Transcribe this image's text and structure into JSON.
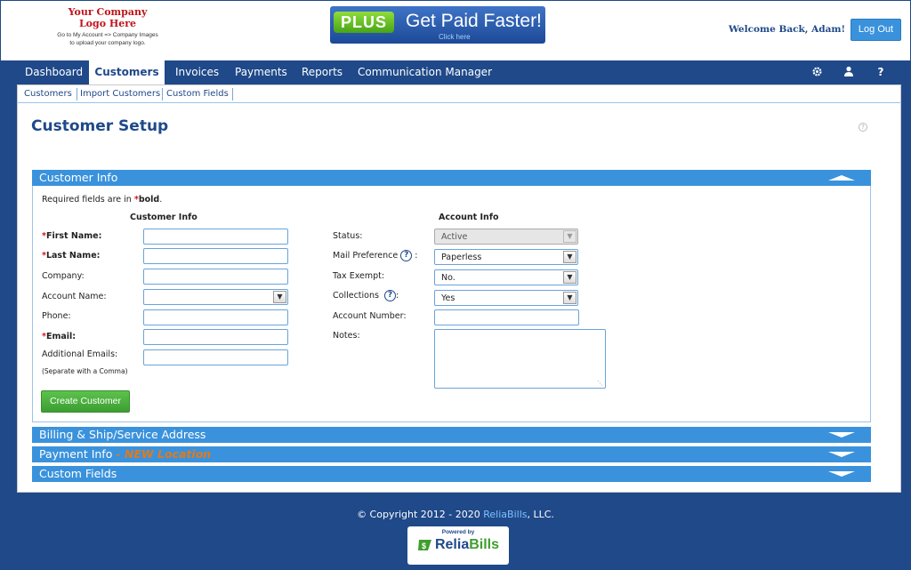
{
  "header": {
    "company_logo_title": "Your Company\nLogo Here",
    "company_logo_hint": "Go to My Account => Company Images to upload your company logo.",
    "promo": {
      "plus": "PLUS",
      "title": "Get Paid Faster!",
      "click": "Click here"
    },
    "welcome": "Welcome Back, Adam!",
    "logout_label": "Log Out"
  },
  "nav": {
    "items": [
      "Dashboard",
      "Customers",
      "Invoices",
      "Payments",
      "Reports",
      "Communication Manager"
    ],
    "active": "Customers",
    "icons": [
      "gear-icon",
      "user-icon",
      "help-icon"
    ]
  },
  "subnav": [
    "Customers",
    "Import Customers",
    "Custom Fields"
  ],
  "page": {
    "title": "Customer Setup"
  },
  "sections": {
    "customer_info": "Customer Info",
    "billing": "Billing & Ship/Service Address",
    "payment": "Payment Info",
    "payment_new": "- NEW Location",
    "custom_fields": "Custom Fields"
  },
  "form": {
    "required_note_prefix": "Required fields are in ",
    "required_note_star": "*",
    "required_note_bold": "bold",
    "required_note_suffix": ".",
    "left_heading": "Customer Info",
    "right_heading": "Account Info",
    "first_name": "First Name:",
    "last_name": "Last Name:",
    "company": "Company:",
    "account_name": "Account Name:",
    "phone": "Phone:",
    "email": "Email:",
    "additional_emails": "Additional Emails:",
    "additional_hint": "(Separate with a Comma)",
    "status": "Status:",
    "status_value": "Active",
    "mail_pref": "Mail Preference",
    "mail_pref_value": "Paperless",
    "tax_exempt": "Tax Exempt:",
    "tax_exempt_value": "No.",
    "collections": "Collections",
    "collections_value": "Yes",
    "account_number": "Account Number:",
    "notes": "Notes:",
    "create_button": "Create Customer"
  },
  "footer": {
    "copy_prefix": "© Copyright 2012 - 2020 ",
    "brand": "ReliaBills",
    "copy_suffix": ", LLC.",
    "powered_by": "Powered by",
    "logo_relia": "Relia",
    "logo_bills": "Bills"
  }
}
